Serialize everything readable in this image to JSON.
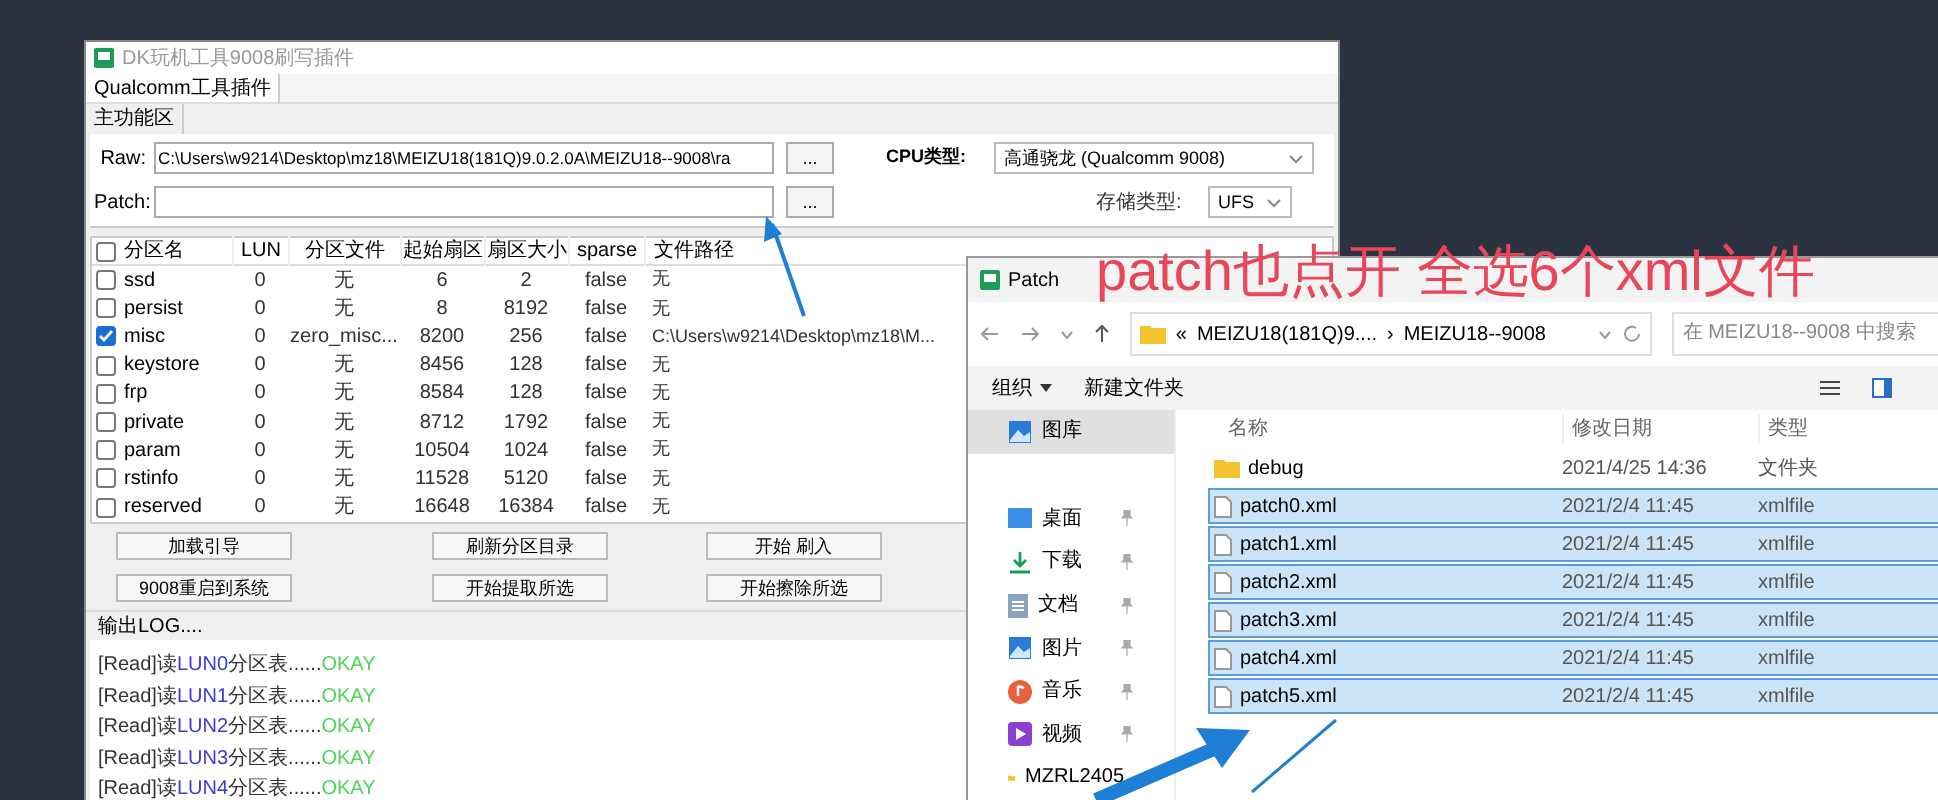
{
  "tool_window": {
    "title": "DK玩机工具9008刷写插件",
    "tabs": [
      {
        "label": "Qualcomm工具插件",
        "selected": true
      }
    ],
    "section": "主功能区",
    "raw": {
      "label": "Raw:",
      "value": "C:\\Users\\w9214\\Desktop\\mz18\\MEIZU18(181Q)9.0.2.0A\\MEIZU18--9008\\ra",
      "button": "..."
    },
    "patch": {
      "label": "Patch:",
      "button": "..."
    },
    "cpu": {
      "label": "CPU类型:",
      "value": "高通骁龙 (Qualcomm 9008)"
    },
    "storage": {
      "label": "存储类型:",
      "value": "UFS"
    },
    "table": {
      "all_checked": false,
      "columns": [
        "分区名",
        "LUN",
        "分区文件",
        "起始扇区",
        "扇区大小",
        "sparse",
        "文件路径"
      ],
      "rows": [
        {
          "checked": false,
          "cells": [
            "ssd",
            "0",
            "无",
            "6",
            "2",
            "false",
            "无"
          ]
        },
        {
          "checked": false,
          "cells": [
            "persist",
            "0",
            "无",
            "8",
            "8192",
            "false",
            "无"
          ]
        },
        {
          "checked": true,
          "cells": [
            "misc",
            "0",
            "zero_misc...",
            "8200",
            "256",
            "false",
            "C:\\Users\\w9214\\Desktop\\mz18\\M..."
          ]
        },
        {
          "checked": false,
          "cells": [
            "keystore",
            "0",
            "无",
            "8456",
            "128",
            "false",
            "无"
          ]
        },
        {
          "checked": false,
          "cells": [
            "frp",
            "0",
            "无",
            "8584",
            "128",
            "false",
            "无"
          ]
        },
        {
          "checked": false,
          "cells": [
            "private",
            "0",
            "无",
            "8712",
            "1792",
            "false",
            "无"
          ]
        },
        {
          "checked": false,
          "cells": [
            "param",
            "0",
            "无",
            "10504",
            "1024",
            "false",
            "无"
          ]
        },
        {
          "checked": false,
          "cells": [
            "rstinfo",
            "0",
            "无",
            "11528",
            "5120",
            "false",
            "无"
          ]
        },
        {
          "checked": false,
          "cells": [
            "reserved",
            "0",
            "无",
            "16648",
            "16384",
            "false",
            "无"
          ]
        }
      ]
    },
    "buttons": [
      "加载引导",
      "刷新分区目录",
      "开始 刷入",
      "9008重启到系统",
      "开始提取所选",
      "开始擦除所选"
    ],
    "log": {
      "label": "输出LOG....",
      "lines": [
        {
          "prefix": "[Read]读",
          "target": "LUN0",
          "middle": "分区表......",
          "status": "OKAY"
        },
        {
          "prefix": "[Read]读",
          "target": "LUN1",
          "middle": "分区表......",
          "status": "OKAY"
        },
        {
          "prefix": "[Read]读",
          "target": "LUN2",
          "middle": "分区表......",
          "status": "OKAY"
        },
        {
          "prefix": "[Read]读",
          "target": "LUN3",
          "middle": "分区表......",
          "status": "OKAY"
        },
        {
          "prefix": "[Read]读",
          "target": "LUN4",
          "middle": "分区表......",
          "status": "OKAY"
        }
      ]
    }
  },
  "annotation": {
    "text": "patch也点开 全选6个xml文件"
  },
  "patch_dialog": {
    "title": "Patch",
    "breadcrumb": [
      "«",
      "MEIZU18(181Q)9....",
      "›",
      "MEIZU18--9008"
    ],
    "search": {
      "placeholder": "在 MEIZU18--9008 中搜索"
    },
    "toolbar": [
      "组织",
      "新建文件夹"
    ],
    "sidebar": [
      {
        "label": "图库",
        "kind": "gallery",
        "selected": true,
        "pinned": false
      },
      {
        "label": "桌面",
        "kind": "desktop",
        "selected": false,
        "pinned": true
      },
      {
        "label": "下载",
        "kind": "download",
        "selected": false,
        "pinned": true
      },
      {
        "label": "文档",
        "kind": "document",
        "selected": false,
        "pinned": true
      },
      {
        "label": "图片",
        "kind": "picture",
        "selected": false,
        "pinned": true
      },
      {
        "label": "音乐",
        "kind": "music",
        "selected": false,
        "pinned": true
      },
      {
        "label": "视频",
        "kind": "video",
        "selected": false,
        "pinned": true
      },
      {
        "label": "MZRL2405",
        "kind": "folder",
        "selected": false,
        "pinned": false
      }
    ],
    "columns": [
      "名称",
      "修改日期",
      "类型"
    ],
    "files": [
      {
        "name": "debug",
        "date": "2021/4/25 14:36",
        "type": "文件夹",
        "kind": "folder",
        "selected": false
      },
      {
        "name": "patch0.xml",
        "date": "2021/2/4 11:45",
        "type": "xmlfile",
        "kind": "file",
        "selected": true
      },
      {
        "name": "patch1.xml",
        "date": "2021/2/4 11:45",
        "type": "xmlfile",
        "kind": "file",
        "selected": true
      },
      {
        "name": "patch2.xml",
        "date": "2021/2/4 11:45",
        "type": "xmlfile",
        "kind": "file",
        "selected": true
      },
      {
        "name": "patch3.xml",
        "date": "2021/2/4 11:45",
        "type": "xmlfile",
        "kind": "file",
        "selected": true
      },
      {
        "name": "patch4.xml",
        "date": "2021/2/4 11:45",
        "type": "xmlfile",
        "kind": "file",
        "selected": true
      },
      {
        "name": "patch5.xml",
        "date": "2021/2/4 11:45",
        "type": "xmlfile",
        "kind": "file",
        "selected": true
      }
    ]
  }
}
